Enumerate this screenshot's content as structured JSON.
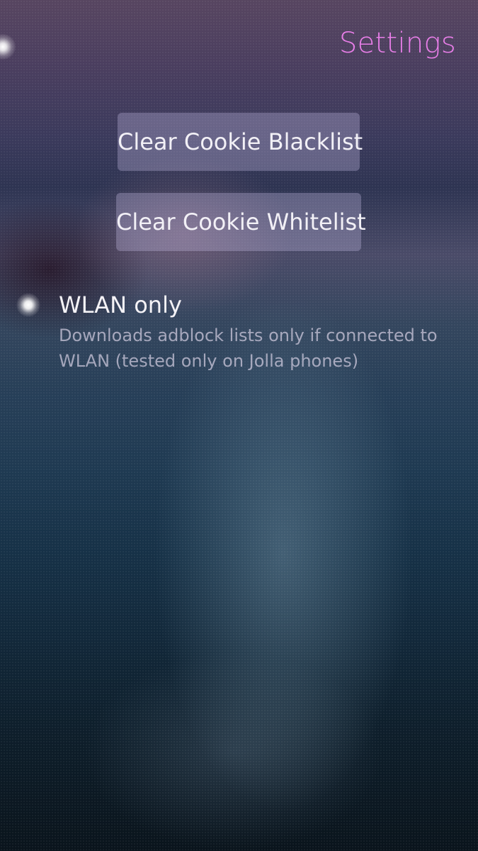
{
  "header": {
    "title": "Settings"
  },
  "buttons": {
    "clear_blacklist": "Clear Cookie Blacklist",
    "clear_whitelist": "Clear Cookie Whitelist"
  },
  "wlan_switch": {
    "label": "WLAN only",
    "description": "Downloads adblock lists only if connected to WLAN (tested only on Jolla phones)",
    "checked": true
  },
  "colors": {
    "title_accent": "#e87ee8",
    "primary_text": "#f4f2f6",
    "secondary_text": "#c8c3d8"
  },
  "icons": {
    "pulley_menu": "pulley-menu-indicator-icon",
    "switch": "glowing-dot-switch-icon"
  }
}
